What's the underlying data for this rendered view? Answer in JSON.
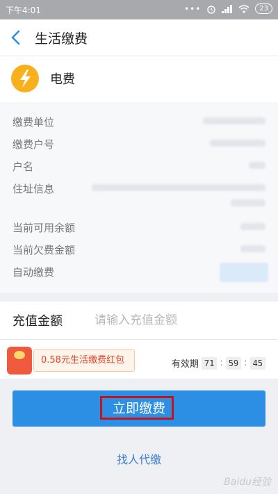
{
  "status_bar": {
    "time": "下午4:01",
    "battery": "23"
  },
  "header": {
    "title": "生活缴费"
  },
  "service": {
    "name": "电费"
  },
  "info_rows": [
    {
      "label": "缴费单位"
    },
    {
      "label": "缴费户号"
    },
    {
      "label": "户名"
    },
    {
      "label": "住址信息"
    },
    {
      "label": "当前可用余额"
    },
    {
      "label": "当前欠费金额"
    },
    {
      "label": "自动缴费"
    }
  ],
  "amount": {
    "label": "充值金额",
    "placeholder": "请输入充值金额"
  },
  "promo": {
    "tag": "0.58元生活缴费红包",
    "validity_label": "有效期",
    "h": "71",
    "m": "59",
    "s": "45"
  },
  "pay_button": {
    "label": "立即缴费"
  },
  "proxy_link": {
    "label": "找人代缴"
  },
  "watermark": "Baidu经验",
  "colors": {
    "accent": "#2d8fe4",
    "highlight": "#c2141c",
    "promo_red": "#e2422b",
    "bolt": "#f8b01c"
  }
}
